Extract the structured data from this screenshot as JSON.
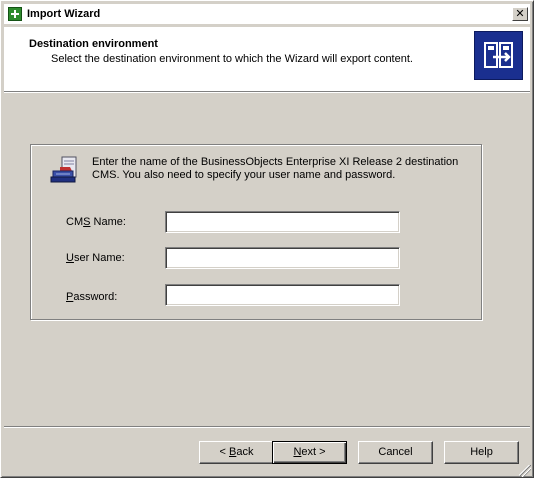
{
  "window": {
    "title": "Import Wizard",
    "close_glyph": "✕",
    "icon": "import-wizard-icon"
  },
  "header": {
    "title": "Destination environment",
    "subtitle": "Select the destination environment to which the Wizard will export content.",
    "icon": "export-arrow-icon"
  },
  "instructions": {
    "text": "Enter the name of the BusinessObjects Enterprise XI Release 2 destination CMS. You also need to specify your user name and password.",
    "icon": "server-login-icon"
  },
  "form": {
    "cms_name": {
      "label_pre": "CM",
      "label_accel": "S",
      "label_post": " Name:",
      "value": ""
    },
    "user_name": {
      "label_pre": "",
      "label_accel": "U",
      "label_post": "ser Name:",
      "value": ""
    },
    "password": {
      "label_pre": "",
      "label_accel": "P",
      "label_post": "assword:",
      "value": ""
    }
  },
  "buttons": {
    "back": {
      "pre": "< ",
      "accel": "B",
      "post": "ack"
    },
    "next": {
      "pre": "",
      "accel": "N",
      "post": "ext >"
    },
    "cancel": {
      "label": "Cancel"
    },
    "help": {
      "label": "Help"
    }
  },
  "colors": {
    "dialog_face": "#d4d0c8",
    "header_background": "#ffffff",
    "header_icon_background": "#1a2f8f"
  }
}
